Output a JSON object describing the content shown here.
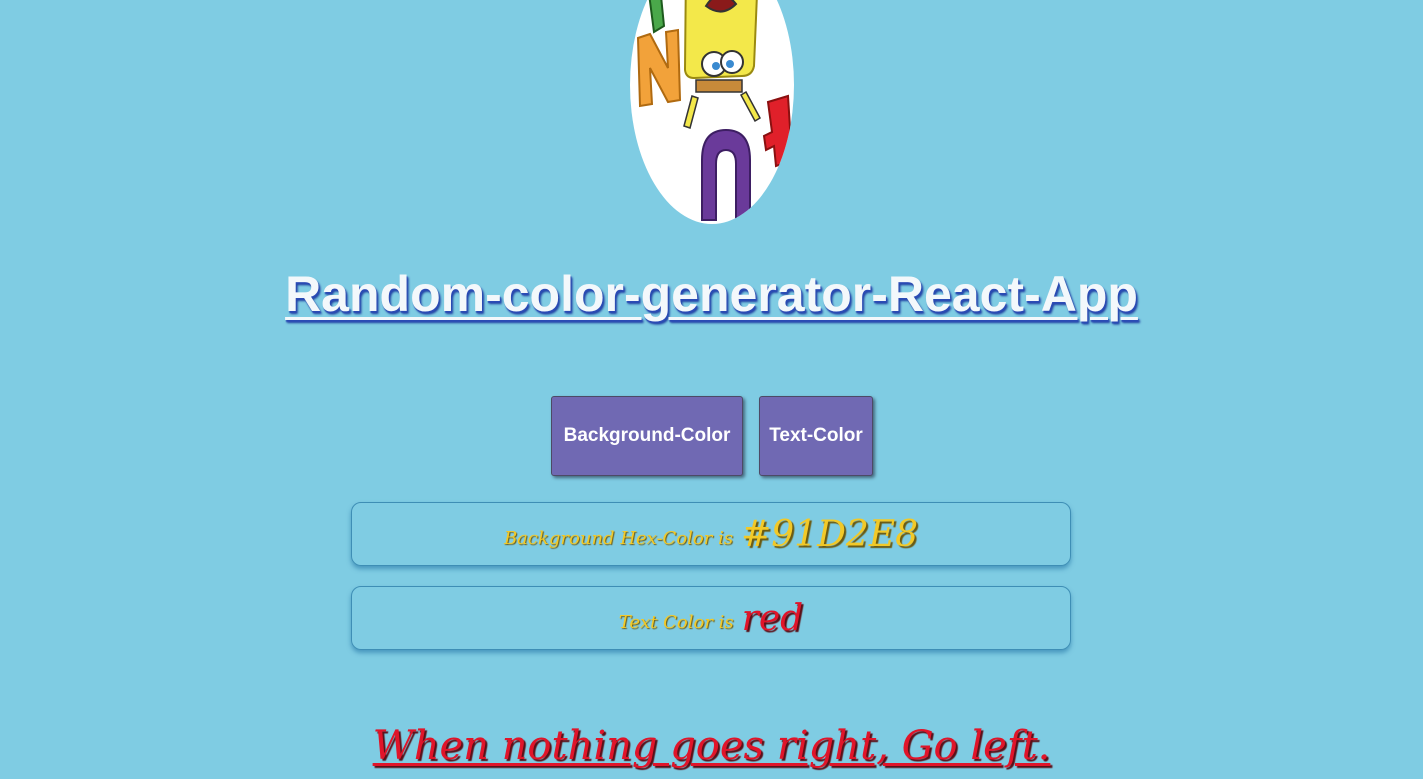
{
  "app": {
    "background_color": "#7FCCE3",
    "title": "Random-color-generator-React-App"
  },
  "logo": {
    "alt": "spongebob-logo"
  },
  "buttons": {
    "background_label": "Background-Color",
    "text_label": "Text-Color",
    "color": "#7069B3"
  },
  "info": {
    "background_label": "Background Hex-Color is",
    "background_value": "#91D2E8",
    "text_label": "Text Color is",
    "text_value": "red"
  },
  "quote": {
    "text": "When nothing goes right, Go left.",
    "color": "red"
  }
}
